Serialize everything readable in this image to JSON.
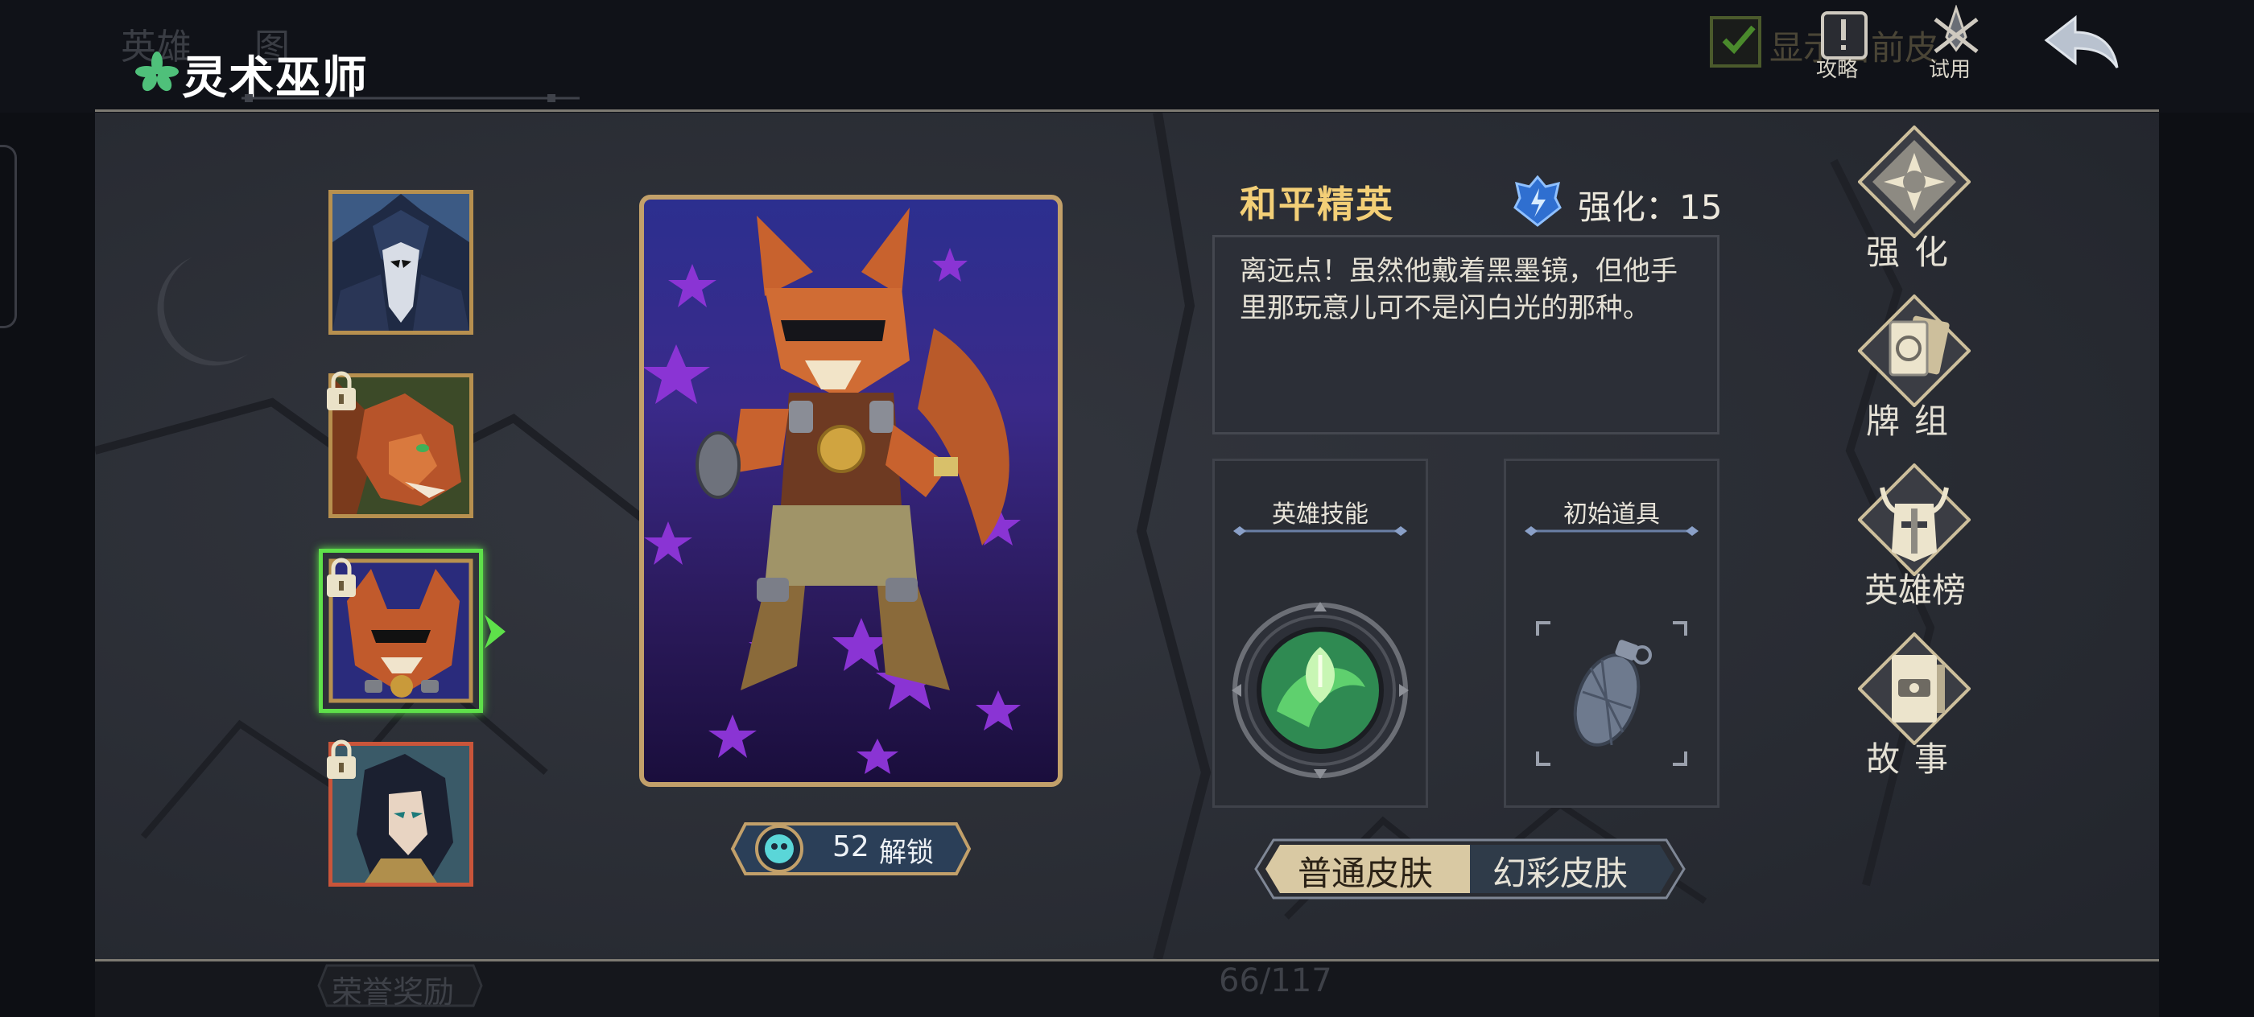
{
  "header": {
    "hero_class": "灵术巫师",
    "behind_tabs": [
      "英雄",
      "图"
    ],
    "show_current_skin": "显示当前皮",
    "guide_label": "攻略",
    "trial_label": "试用"
  },
  "hero_list": [
    {
      "name": "wolf-mage",
      "locked": false,
      "selected": false
    },
    {
      "name": "fox-brawler",
      "locked": true,
      "selected": false
    },
    {
      "name": "fox-elite",
      "locked": true,
      "selected": true
    },
    {
      "name": "swordsman",
      "locked": true,
      "selected": false
    }
  ],
  "card": {
    "unlock_cost": "52",
    "unlock_label": "解锁"
  },
  "info": {
    "skin_name": "和平精英",
    "enhance_text": "强化：15",
    "description": "离远点！虽然他戴着黑墨镜，但他手里那玩意儿可不是闪白光的那种。",
    "skill_title": "英雄技能",
    "item_title": "初始道具",
    "skin_normal": "普通皮肤",
    "skin_illusion": "幻彩皮肤"
  },
  "side_menu": [
    {
      "label": "强化",
      "icon": "star-compass-icon"
    },
    {
      "label": "牌组",
      "icon": "card-deck-icon"
    },
    {
      "label": "英雄榜",
      "icon": "helmet-icon"
    },
    {
      "label": "故事",
      "icon": "story-book-icon"
    }
  ],
  "footer": {
    "honor_reward": "荣誉奖励",
    "page_counter": "66/117"
  },
  "colors": {
    "gold": "#c2a06a",
    "selected_green": "#5ee04a",
    "skin_name": "#f3cf77",
    "panel": "#2a2d35"
  }
}
